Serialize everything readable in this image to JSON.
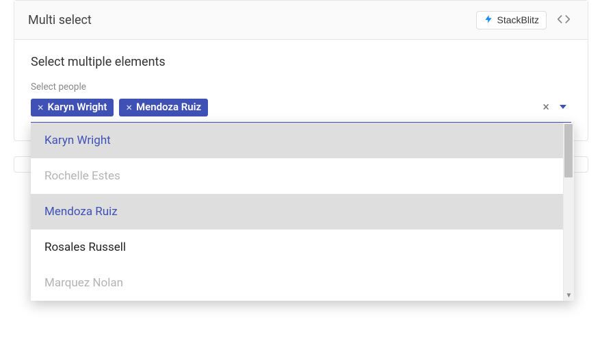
{
  "card": {
    "title": "Multi select",
    "stackblitz_label": "StackBlitz"
  },
  "section": {
    "heading": "Select multiple elements",
    "field_label": "Select people"
  },
  "selected_chips": [
    {
      "label": "Karyn Wright"
    },
    {
      "label": "Mendoza Ruiz"
    }
  ],
  "options": [
    {
      "label": "Karyn Wright",
      "state": "selected"
    },
    {
      "label": "Rochelle Estes",
      "state": "disabled"
    },
    {
      "label": "Mendoza Ruiz",
      "state": "selected"
    },
    {
      "label": "Rosales Russell",
      "state": "normal"
    },
    {
      "label": "Marquez Nolan",
      "state": "disabled"
    }
  ],
  "colors": {
    "accent": "#3f51b5",
    "stackblitz_bolt": "#1389fd"
  }
}
